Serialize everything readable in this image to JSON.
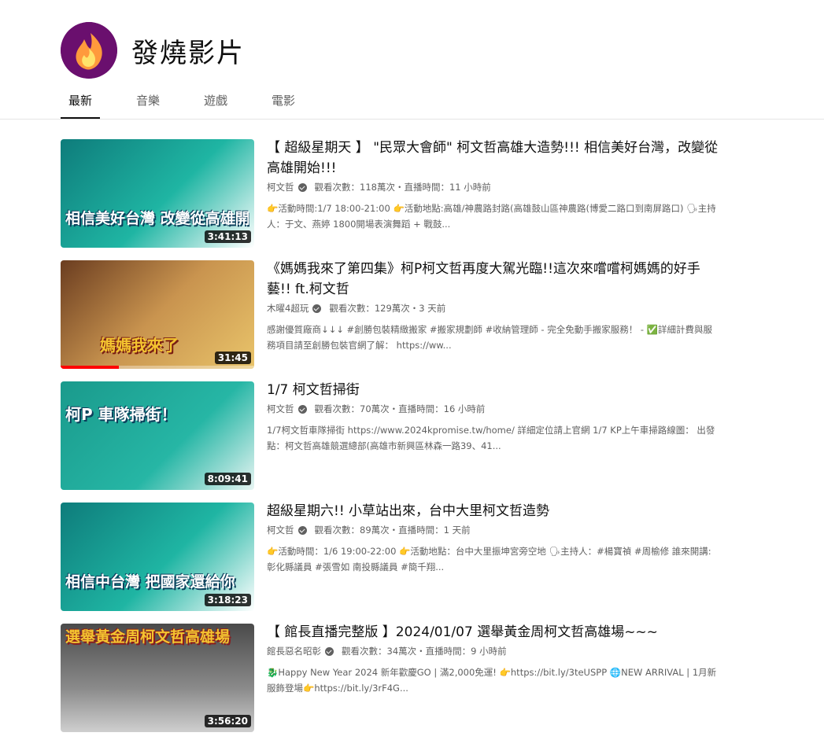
{
  "channel": {
    "name": "發燒影片",
    "logo_icon": "flame-logo-icon",
    "accent": "#6a0f6e"
  },
  "tabs": [
    {
      "label": "最新",
      "active": true
    },
    {
      "label": "音樂",
      "active": false
    },
    {
      "label": "遊戲",
      "active": false
    },
    {
      "label": "電影",
      "active": false
    }
  ],
  "videos": [
    {
      "title": "【 超級星期天 】 \"民眾大會師\" 柯文哲高雄大造勢!!! 相信美好台灣，改變從高雄開始!!!",
      "channel": "柯文哲",
      "stats": "觀看次數：118萬次・直播時間：11 小時前",
      "description": "👉活動時間:1/7 18:00-21:00 👉活動地點:高雄/神農路封路(高雄鼓山區神農路(博愛二路口到南屏路口) 🗣主持人：于文、燕婷 1800開場表演舞蹈 + 戰鼓...",
      "duration": "3:41:13",
      "progress": 0.0,
      "thumb_caption": "相信美好台灣 改變從高雄開始",
      "thumb_colors": [
        "#0e7c7b",
        "#1fb5a3"
      ]
    },
    {
      "title": "《媽媽我來了第四集》柯P柯文哲再度大駕光臨!!這次來嚐嚐柯媽媽的好手藝!! ft.柯文哲",
      "channel": "木曜4超玩",
      "stats": "觀看次數：129萬次・3 天前",
      "description": "感謝優質廠商↓↓↓ #創勝包裝精緻搬家 #搬家規劃師 #收納管理師 - 完全免動手搬家服務！ - ✅詳細計費與服務項目請至創勝包裝官網了解： https://ww...",
      "duration": "31:45",
      "progress": 0.3,
      "thumb_caption": "媽媽我來了",
      "thumb_colors": [
        "#7a4a2a",
        "#c9944f"
      ]
    },
    {
      "title": "1/7 柯文哲掃街",
      "channel": "柯文哲",
      "stats": "觀看次數：70萬次・直播時間：16 小時前",
      "description": "1/7柯文哲車隊掃街 https://www.2024kpromise.tw/home/ 詳細定位請上官網 1/7 KP上午車掃路線圖： 出發點：柯文哲高雄競選總部(高雄市新興區林森一路39、41...",
      "duration": "8:09:41",
      "progress": 0.0,
      "thumb_caption": "柯P 車隊掃街！",
      "thumb_colors": [
        "#1a9a8c",
        "#26b6a5"
      ]
    },
    {
      "title": "超級星期六!! 小草站出來，台中大里柯文哲造勢",
      "channel": "柯文哲",
      "stats": "觀看次數：89萬次・直播時間：1 天前",
      "description": "👉活動時間：1/6 19:00-22:00 👉活動地點：台中大里振坤宮旁空地 🗣主持人：#楊寶禎 #周榆修 誰來開講:彰化縣議員 #張雪如 南投縣議員 #簡千翔...",
      "duration": "3:18:23",
      "progress": 0.0,
      "thumb_caption": "相信中台灣 把國家還給你",
      "thumb_colors": [
        "#0e7c7b",
        "#1fb5a3"
      ]
    },
    {
      "title": "【 館長直播完整版 】2024/01/07 選舉黃金周柯文哲高雄場~~~",
      "channel": "館長惡名昭彰",
      "stats": "觀看次數：34萬次・直播時間：9 小時前",
      "description": "🐉Happy New Year 2024 新年歡慶GO | 滿2,000免運! 👉https://bit.ly/3teUSPP 🌐NEW ARRIVAL | 1月新服飾登場👉https://bit.ly/3rF4G...",
      "duration": "3:56:20",
      "progress": 0.0,
      "thumb_caption": "選舉黃金周柯文哲高雄場",
      "thumb_colors": [
        "#3a3a3a",
        "#8b8b8b"
      ]
    }
  ]
}
